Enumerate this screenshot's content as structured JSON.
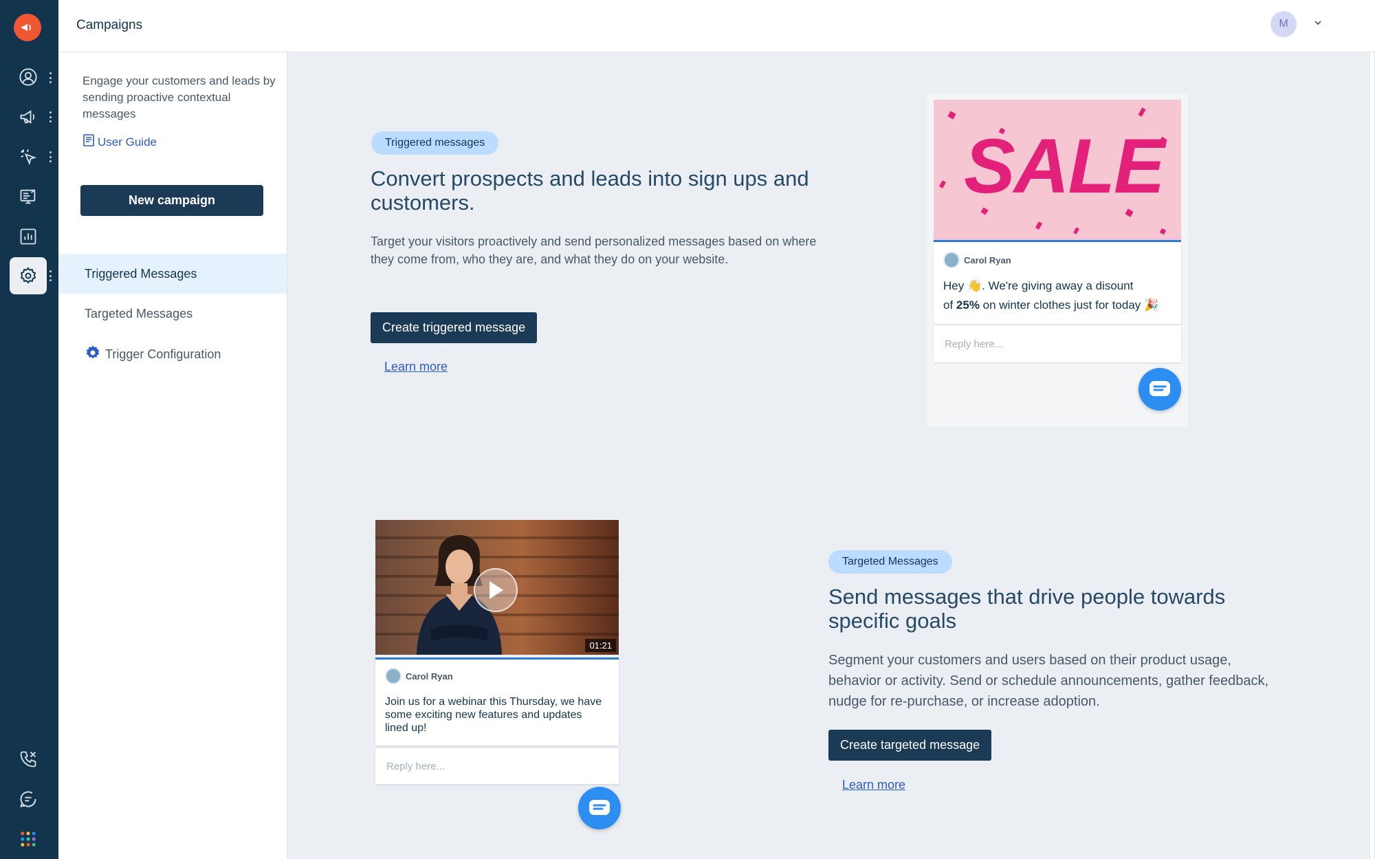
{
  "topbar": {
    "title": "Campaigns",
    "avatar_initial": "M"
  },
  "rail": {
    "icons": [
      "megaphone-logo-icon",
      "contacts-icon",
      "campaigns-icon",
      "click-icon",
      "forms-icon",
      "reports-icon",
      "settings-icon",
      "phone-icon",
      "chat-icon",
      "app-grid-icon"
    ]
  },
  "subnav": {
    "description": "Engage your customers and leads by sending proactive contextual messages",
    "user_guide": "User Guide",
    "new_campaign": "New campaign",
    "items": [
      {
        "label": "Triggered Messages",
        "active": true
      },
      {
        "label": "Targeted Messages",
        "active": false
      },
      {
        "label": "Trigger Configuration",
        "active": false
      }
    ]
  },
  "triggered": {
    "pill": "Triggered messages",
    "heading": "Convert prospects and leads into sign ups and customers.",
    "body": "Target your visitors proactively and send personalized messages based on where they come from, who they are, and what they do on your website.",
    "button": "Create triggered message",
    "learn_more": "Learn more",
    "preview": {
      "image_text": "SALE",
      "sender": "Carol Ryan",
      "message_line1_a": "Hey ",
      "wave_emoji": "👋",
      "message_line1_b": ". We're giving away a disount",
      "message_line2_a": "of ",
      "message_bold": "25%",
      "message_line2_b": " on winter clothes just for today ",
      "party_emoji": "🎉",
      "reply_placeholder": "Reply here..."
    }
  },
  "targeted": {
    "pill": "Targeted Messages",
    "heading": "Send messages that drive people towards specific goals",
    "body": "Segment your customers and users based on their product usage, behavior or activity. Send or schedule announcements, gather feedback, nudge for re-purchase, or increase adoption.",
    "button": "Create targeted message",
    "learn_more": "Learn more",
    "preview": {
      "duration": "01:21",
      "sender": "Carol Ryan",
      "message": "Join us for a webinar this Thursday, we have some exciting new features and updates lined up!",
      "reply_placeholder": "Reply here..."
    }
  },
  "colors": {
    "rail": "#12344d",
    "accent": "#2c5cc5",
    "button": "#1b3a55",
    "pill": "#bbdcfe",
    "sale_pink": "#e3217a"
  }
}
